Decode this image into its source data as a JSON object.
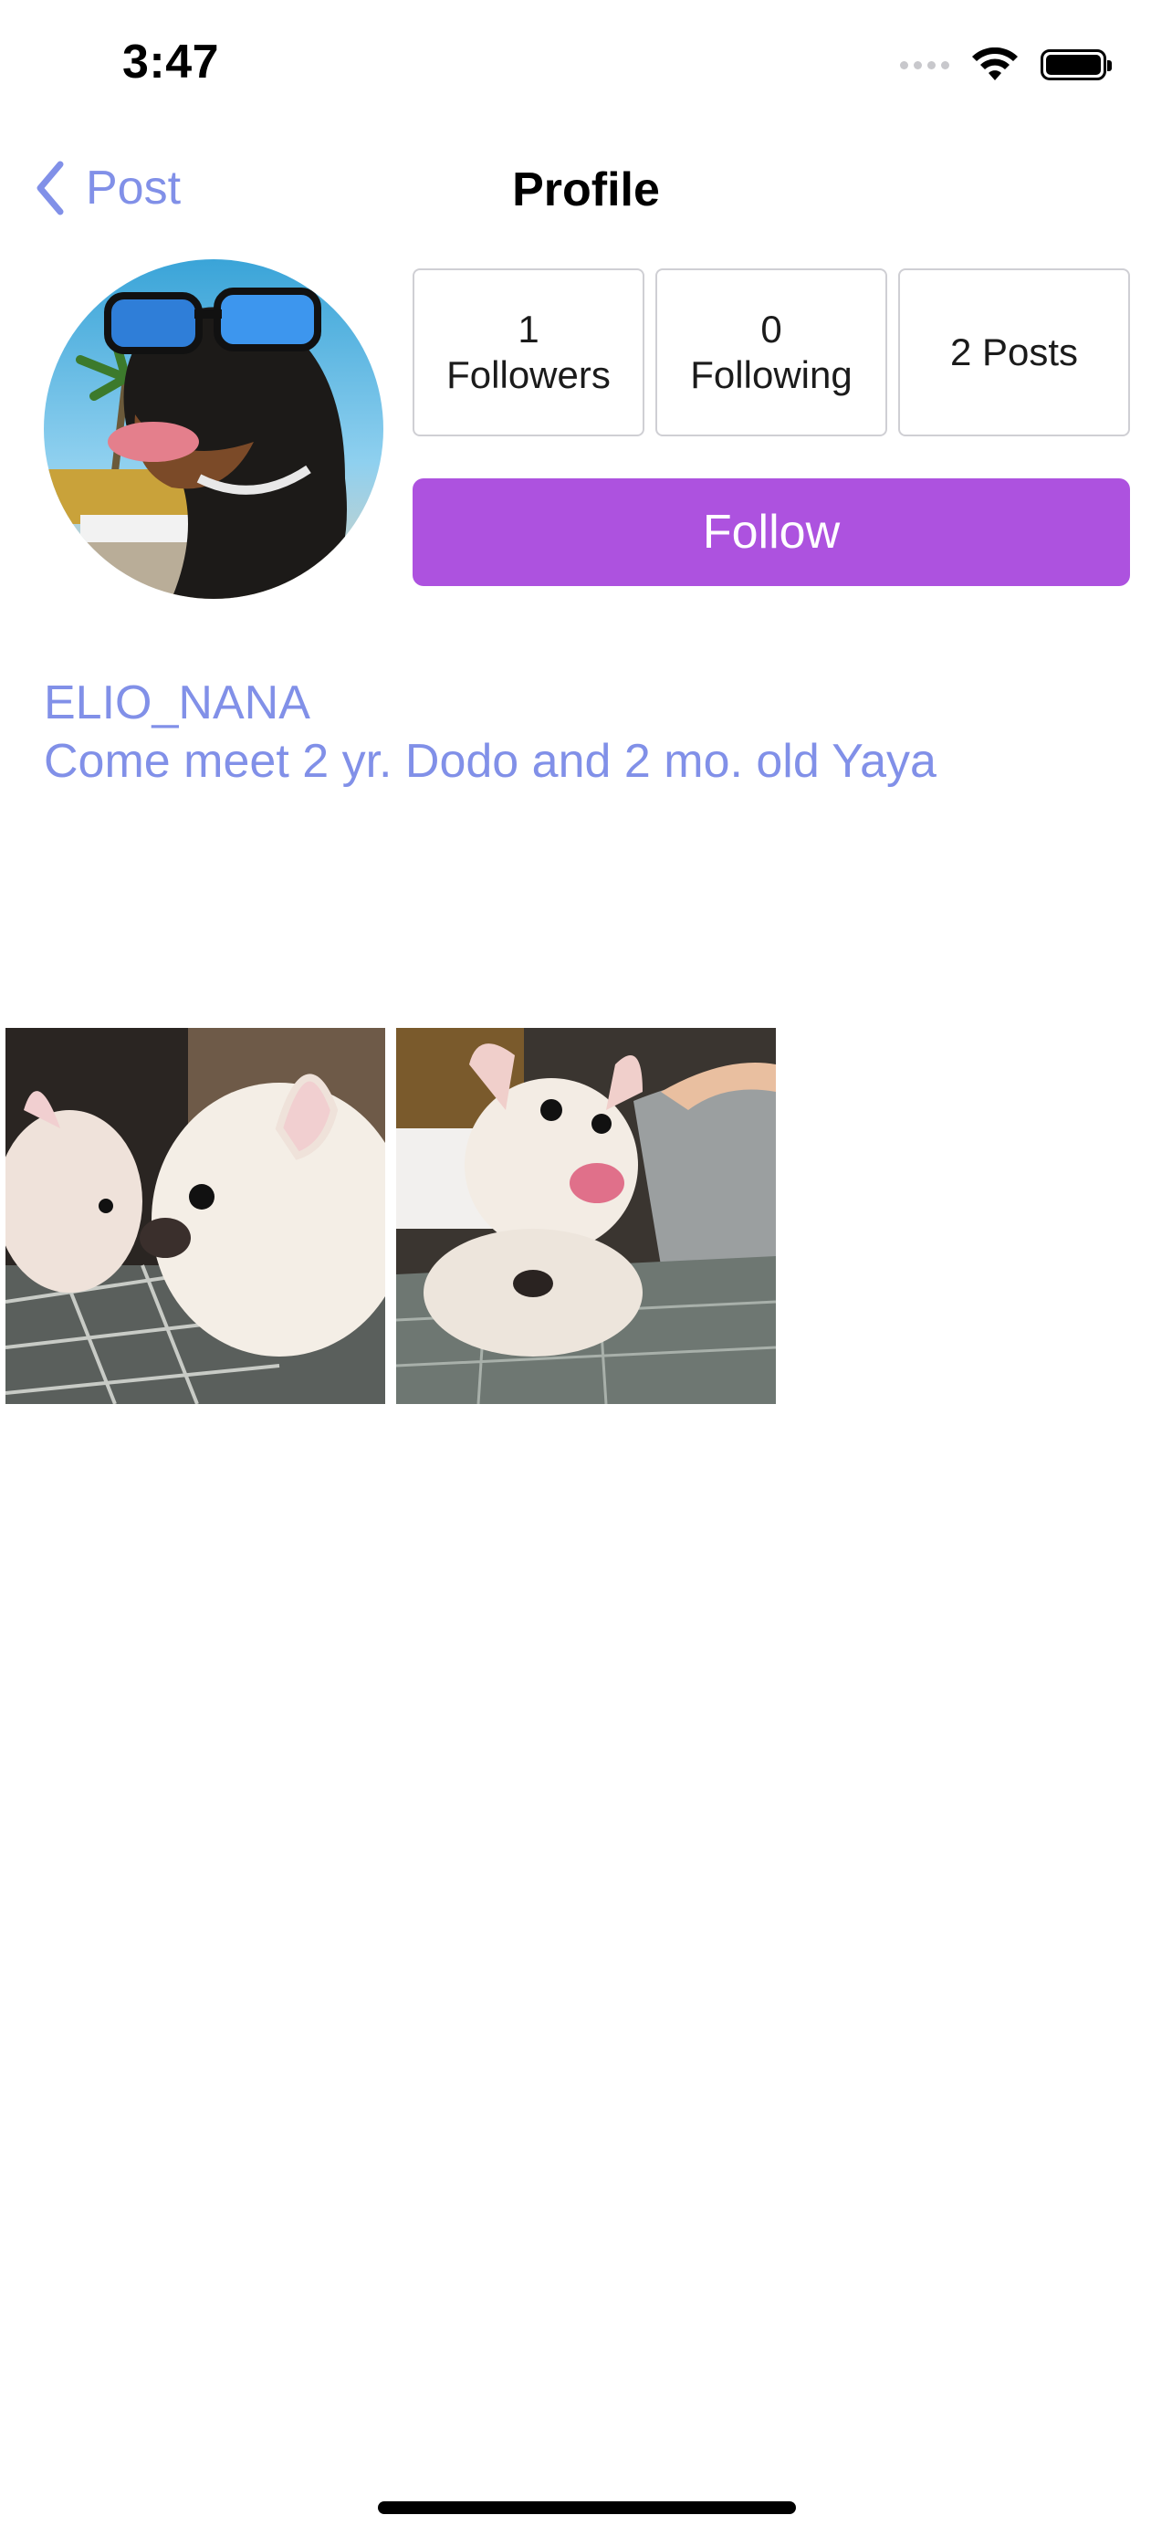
{
  "status_bar": {
    "time": "3:47"
  },
  "nav": {
    "back_label": "Post",
    "title": "Profile"
  },
  "profile": {
    "stats": {
      "followers_count": "1",
      "followers_label": "Followers",
      "following_count": "0",
      "following_label": "Following",
      "posts_label": "2 Posts"
    },
    "follow_label": "Follow",
    "username": "ELIO_NANA",
    "bio": "Come meet 2 yr. Dodo and 2 mo. old Yaya"
  },
  "colors": {
    "accent": "#8190e8",
    "follow_button": "#ad52df"
  },
  "icons": {
    "back": "chevron-left-icon",
    "wifi": "wifi-icon",
    "battery": "battery-icon",
    "signal": "cellular-signal-icon"
  }
}
